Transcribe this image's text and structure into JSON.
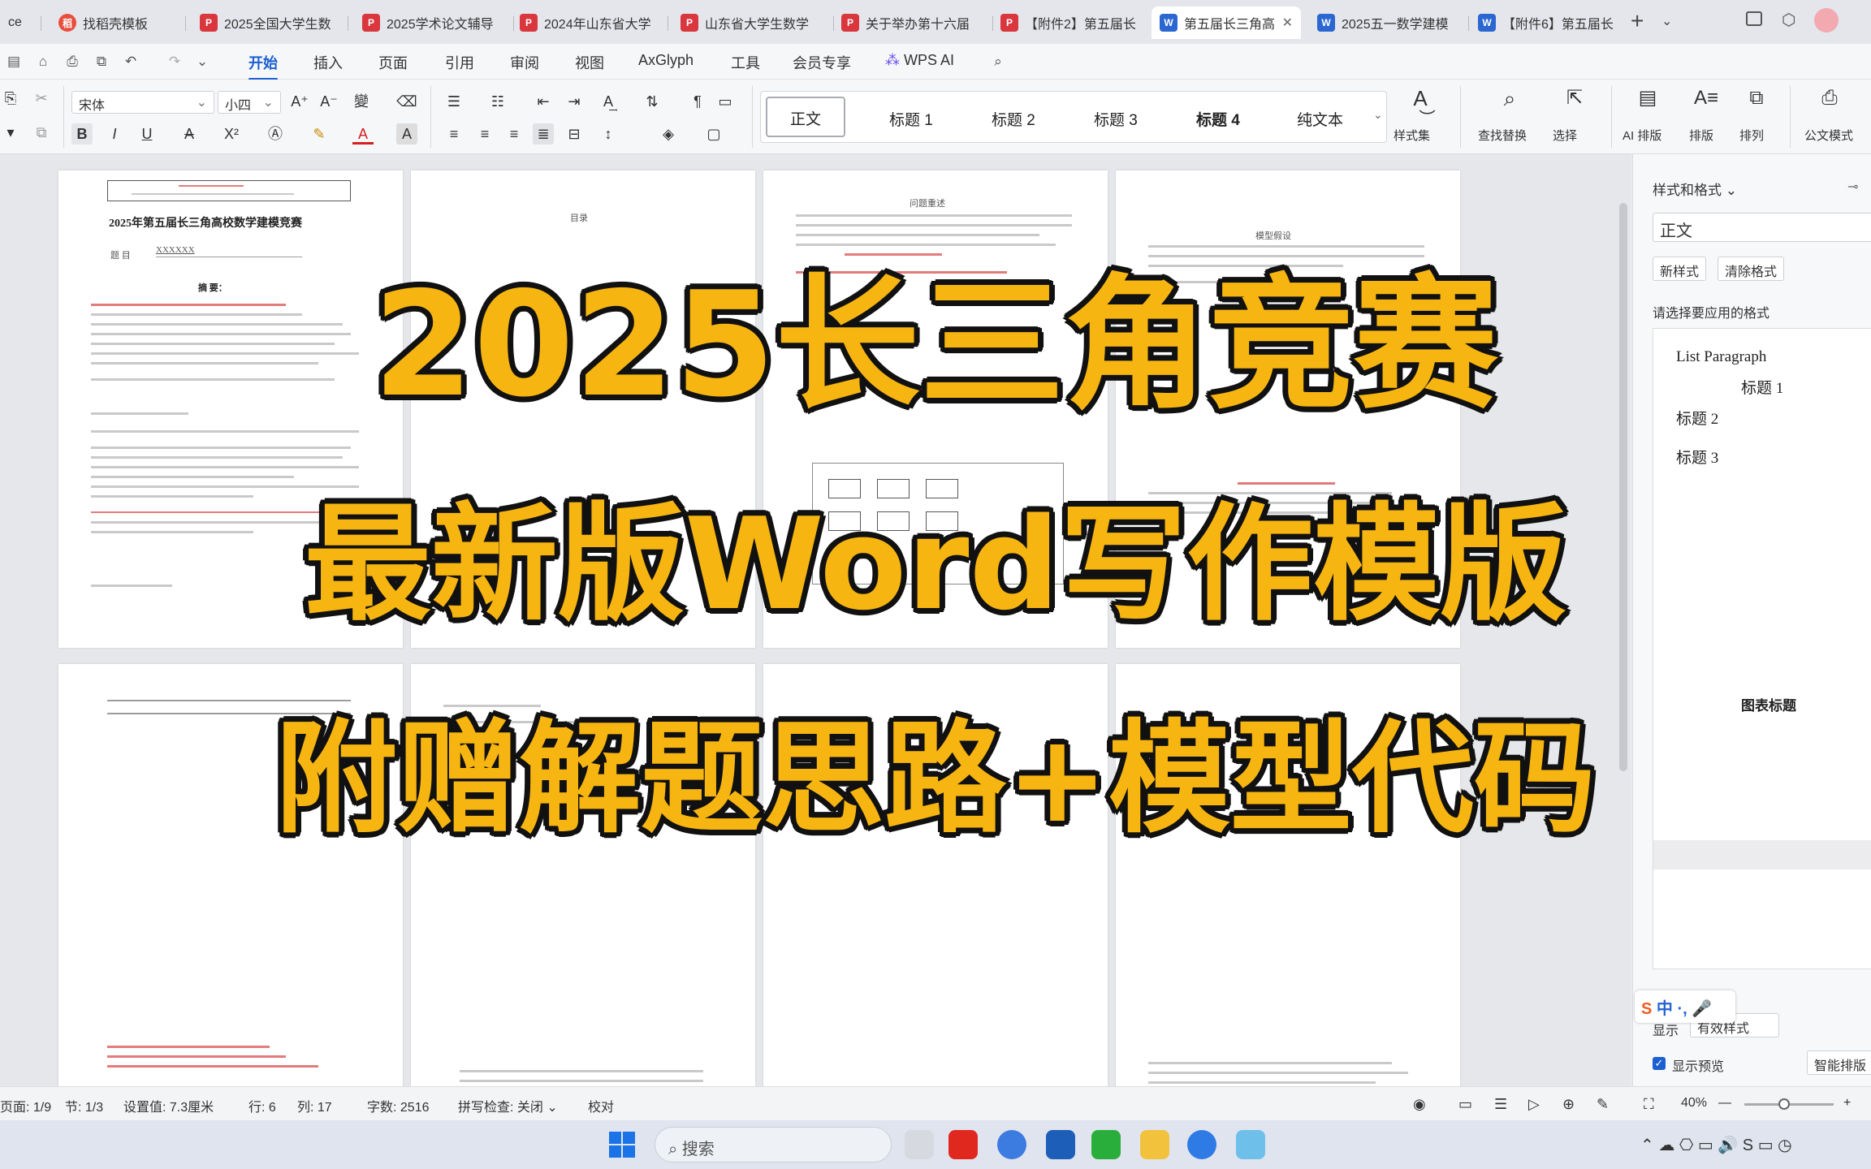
{
  "tabs": [
    {
      "label": "ce",
      "icon": "none"
    },
    {
      "label": "找稻壳模板",
      "icon": "docer-icon"
    },
    {
      "label": "2025全国大学生数",
      "icon": "pdf-icon"
    },
    {
      "label": "2025学术论文辅导",
      "icon": "pdf-icon"
    },
    {
      "label": "2024年山东省大学",
      "icon": "pdf-icon"
    },
    {
      "label": "山东省大学生数学",
      "icon": "pdf-icon"
    },
    {
      "label": "关于举办第十六届",
      "icon": "pdf-icon"
    },
    {
      "label": "【附件2】第五届长",
      "icon": "pdf-icon"
    },
    {
      "label": "第五届长三角高",
      "icon": "word-icon"
    },
    {
      "label": "2025五一数学建模",
      "icon": "word-icon"
    },
    {
      "label": "【附件6】第五届长",
      "icon": "word-icon"
    }
  ],
  "menu": [
    "开始",
    "插入",
    "页面",
    "引用",
    "审阅",
    "视图",
    "AxGlyph",
    "工具",
    "会员专享",
    "WPS AI"
  ],
  "ribbon": {
    "font_name": "宋体",
    "font_size": "小四",
    "styles": [
      "正文",
      "标题 1",
      "标题 2",
      "标题 3",
      "标题 4",
      "纯文本"
    ],
    "tools": [
      "样式集",
      "查找替换",
      "选择",
      "AI 排版",
      "排版",
      "排列",
      "公文模式"
    ]
  },
  "page1": {
    "title": "2025年第五届长三角高校数学建模竞赛",
    "subject_label": "题    目",
    "subject_value": "XXXXXX",
    "abstract_label": "摘    要："
  },
  "page2": {
    "title": "目录"
  },
  "page3": {
    "title": "问题重述"
  },
  "page4": {
    "title": "模型假设"
  },
  "panel": {
    "title": "样式和格式",
    "current_style": "正文",
    "new_style": "新样式",
    "clear_style": "清除格式",
    "prompt": "请选择要应用的格式",
    "items": [
      "List Paragraph",
      "标题 1",
      "标题 2",
      "标题 3",
      "图表标题"
    ],
    "show_label": "显示",
    "show_value": "有效样式",
    "preview_label": "显示预览",
    "smart_button": "智能排版"
  },
  "status": {
    "page": "页面: 1/9",
    "section": "节: 1/3",
    "setting": "设置值: 7.3厘米",
    "row": "行: 6",
    "col": "列: 17",
    "words": "字数: 2516",
    "spell": "拼写检查: 关闭",
    "proof": "校对",
    "zoom": "40%"
  },
  "taskbar": {
    "search": "搜索"
  },
  "overlay": {
    "line1": "2025长三角竞赛",
    "line2": "最新版Word写作模版",
    "line3": "附赠解题思路+模型代码"
  },
  "colors": {
    "overlay_text": "#f7b511",
    "accent": "#1b5fd0"
  }
}
